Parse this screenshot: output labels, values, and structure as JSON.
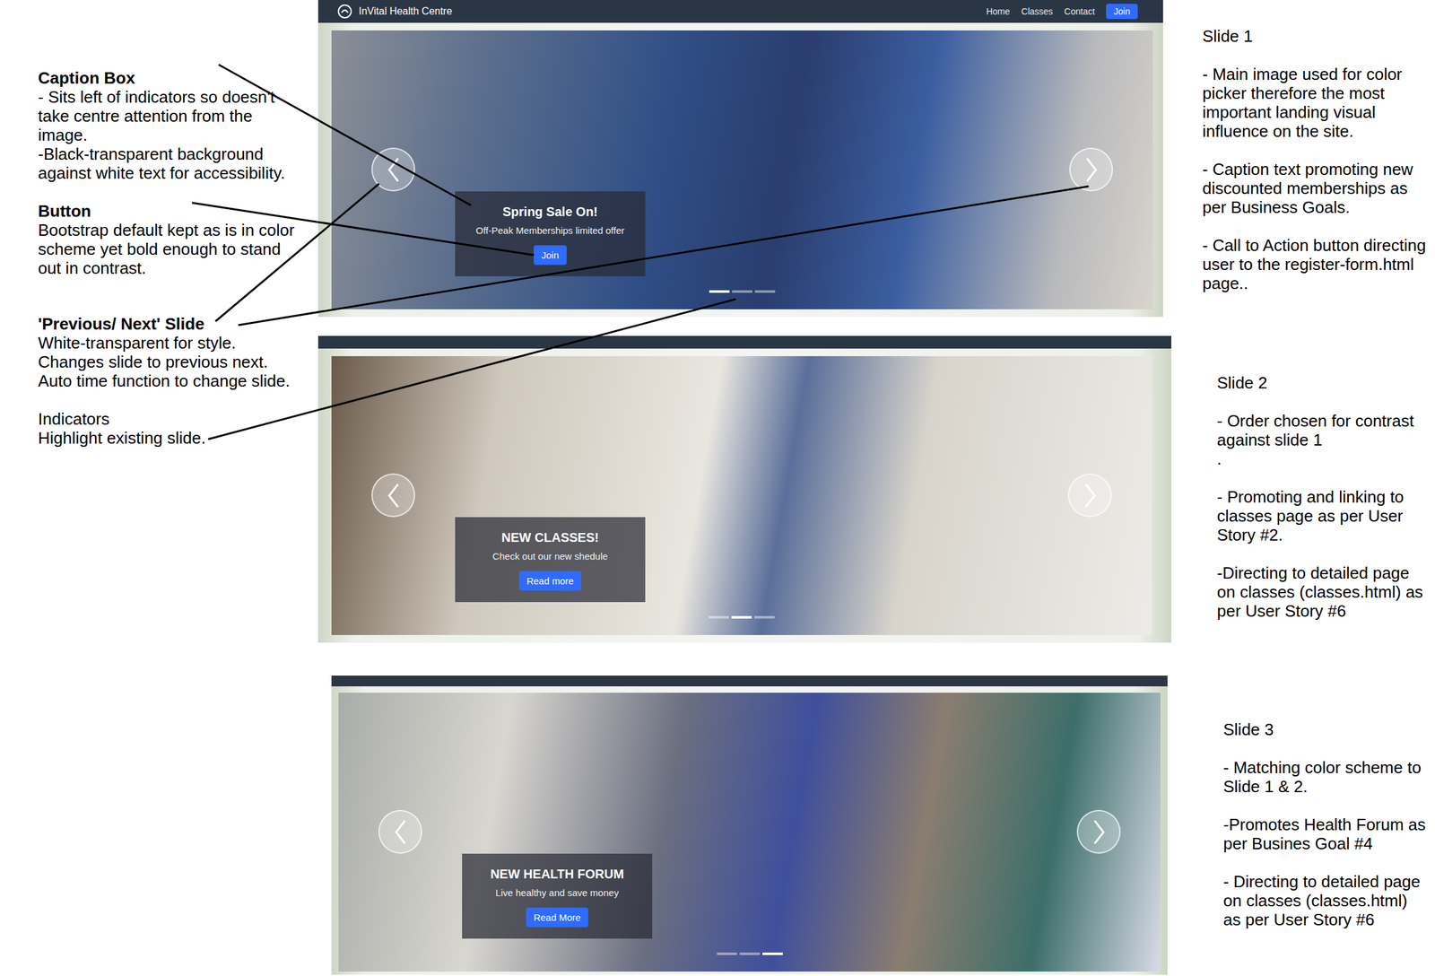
{
  "navbar": {
    "brand": "InVital Health Centre",
    "links": [
      "Home",
      "Classes",
      "Contact"
    ],
    "button": "Join"
  },
  "annotations": [
    {
      "title": "Caption Box",
      "bold": true,
      "lines": [
        "- Sits left of indicators so doesn't take centre attention from the image.",
        "-Black-transparent background against white text for accessibility."
      ]
    },
    {
      "title": "Button",
      "bold": true,
      "lines": [
        "Bootstrap default kept as is in color scheme yet bold enough to stand out in contrast."
      ]
    },
    {
      "title": "'Previous/ Next' Slide",
      "bold": true,
      "lines": [
        "White-transparent for style.",
        "Changes slide to previous next.",
        "Auto time function to change slide."
      ]
    },
    {
      "title": "Indicators",
      "bold": false,
      "lines": [
        "Highlight existing slide."
      ]
    }
  ],
  "slides": [
    {
      "heading": "Spring Sale On!",
      "text": "Off-Peak Memberships limited offer",
      "button": "Join",
      "indicators": [
        {
          "selected": true
        },
        {
          "selected": false
        },
        {
          "selected": false
        }
      ]
    },
    {
      "heading": "NEW CLASSES!",
      "text": "Check out our new shedule",
      "button": "Read more",
      "indicators": [
        {
          "selected": false
        },
        {
          "selected": true
        },
        {
          "selected": false
        }
      ]
    },
    {
      "heading": "NEW HEALTH FORUM",
      "text": "Live healthy and save money",
      "button": "Read More",
      "indicators": [
        {
          "selected": false
        },
        {
          "selected": false
        },
        {
          "selected": true
        }
      ]
    }
  ],
  "notes": [
    {
      "title": "Slide 1",
      "points": [
        [
          "- Main image used for color picker therefore the most important landing visual influence on the site."
        ],
        [
          "- Caption text promoting new discounted memberships as per Business Goals."
        ],
        [
          "- Call to Action button directing user to the register-form.html page.."
        ]
      ]
    },
    {
      "title": "Slide 2",
      "points": [
        [
          "- Order chosen for contrast against slide 1",
          "."
        ],
        [
          "- Promoting and linking to classes page as per User Story #2."
        ],
        [
          "-Directing to detailed page on classes (classes.html) as per User Story #6"
        ]
      ]
    },
    {
      "title": "Slide 3",
      "points": [
        [
          "- Matching color scheme to Slide 1 & 2."
        ],
        [
          "-Promotes Health Forum as per Busines Goal #4"
        ],
        [
          "- Directing to detailed page on classes (classes.html) as per User Story #6"
        ]
      ]
    }
  ]
}
